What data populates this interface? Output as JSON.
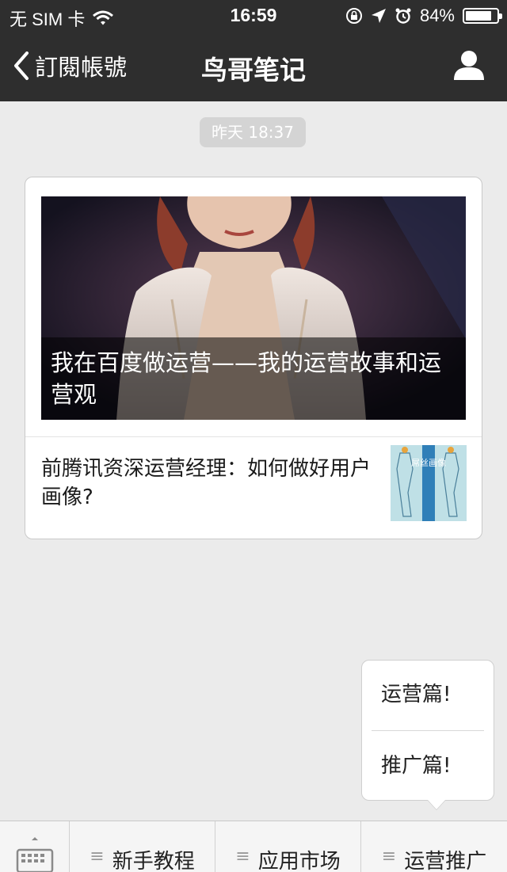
{
  "status_bar": {
    "carrier": "无 SIM 卡",
    "time": "16:59",
    "battery": "84%",
    "battery_level": 0.84,
    "icons": [
      "wifi-icon",
      "rotation-lock-icon",
      "location-arrow-icon",
      "alarm-icon",
      "battery-icon"
    ]
  },
  "nav": {
    "back_label": "訂閱帳號",
    "title": "鸟哥笔记",
    "icons": [
      "chevron-left-icon",
      "profile-icon"
    ]
  },
  "chat": {
    "timestamp": "昨天 18:37"
  },
  "article": {
    "main_title": "我在百度做运营——我的运营故事和运营观",
    "sub_title": "前腾讯资深运营经理：如何做好用户画像?",
    "thumb_text": "屌丝画像"
  },
  "popup_menu": {
    "items": [
      "运营篇!",
      "推广篇!"
    ]
  },
  "menu_bar": {
    "items": [
      "新手教程",
      "应用市场",
      "运营推广"
    ],
    "icons": [
      "keyboard-icon",
      "menu-lines-icon"
    ]
  },
  "colors": {
    "bar_dark": "#2e2e2e",
    "background": "#ebebeb",
    "card": "#ffffff"
  }
}
